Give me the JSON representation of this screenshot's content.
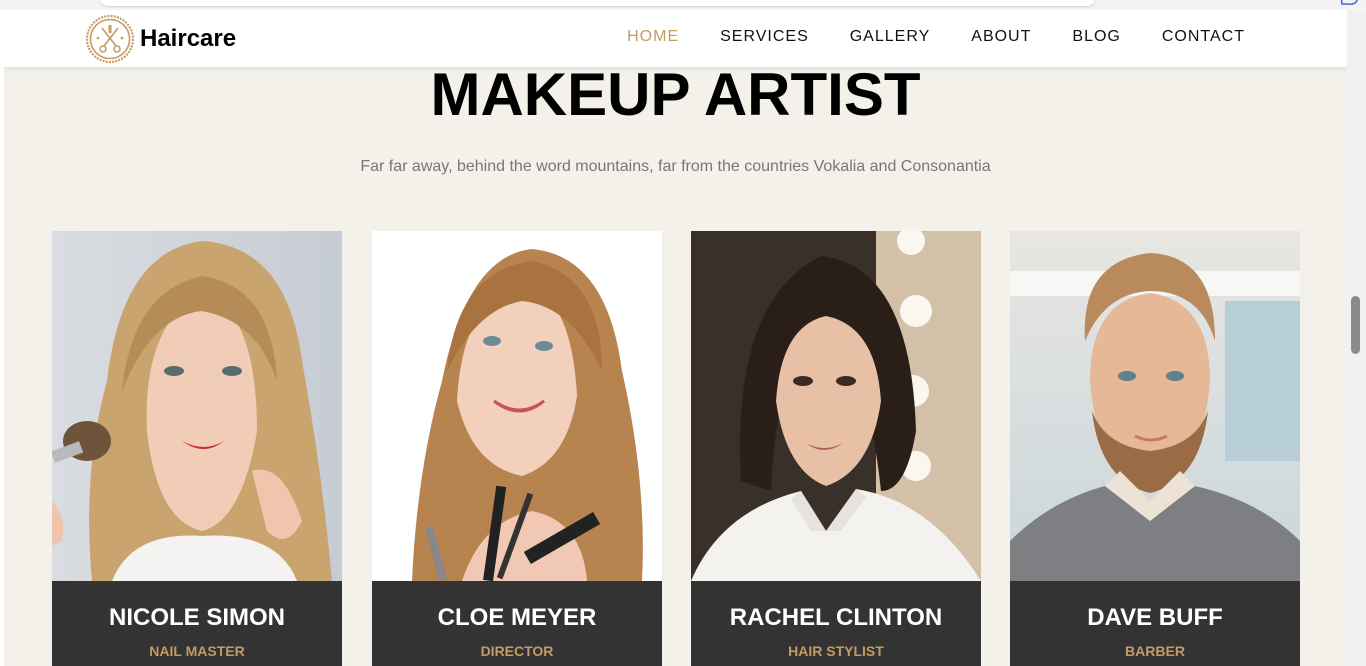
{
  "brand": {
    "name": "Haircare"
  },
  "nav": {
    "items": [
      {
        "label": "HOME",
        "active": true
      },
      {
        "label": "SERVICES",
        "active": false
      },
      {
        "label": "GALLERY",
        "active": false
      },
      {
        "label": "ABOUT",
        "active": false
      },
      {
        "label": "BLOG",
        "active": false
      },
      {
        "label": "CONTACT",
        "active": false
      }
    ]
  },
  "section": {
    "title": "MAKEUP ARTIST",
    "subtitle": "Far far away, behind the word mountains, far from the countries Vokalia and Consonantia"
  },
  "team": [
    {
      "name": "NICOLE SIMON",
      "role": "NAIL MASTER"
    },
    {
      "name": "CLOE MEYER",
      "role": "DIRECTOR"
    },
    {
      "name": "RACHEL CLINTON",
      "role": "HAIR STYLIST"
    },
    {
      "name": "DAVE BUFF",
      "role": "BARBER"
    }
  ],
  "colors": {
    "accent": "#c49b63",
    "page_background": "#f3f1ea",
    "caption_background": "#333333"
  },
  "icons": {
    "logo": "scissors-comb-badge-icon"
  }
}
